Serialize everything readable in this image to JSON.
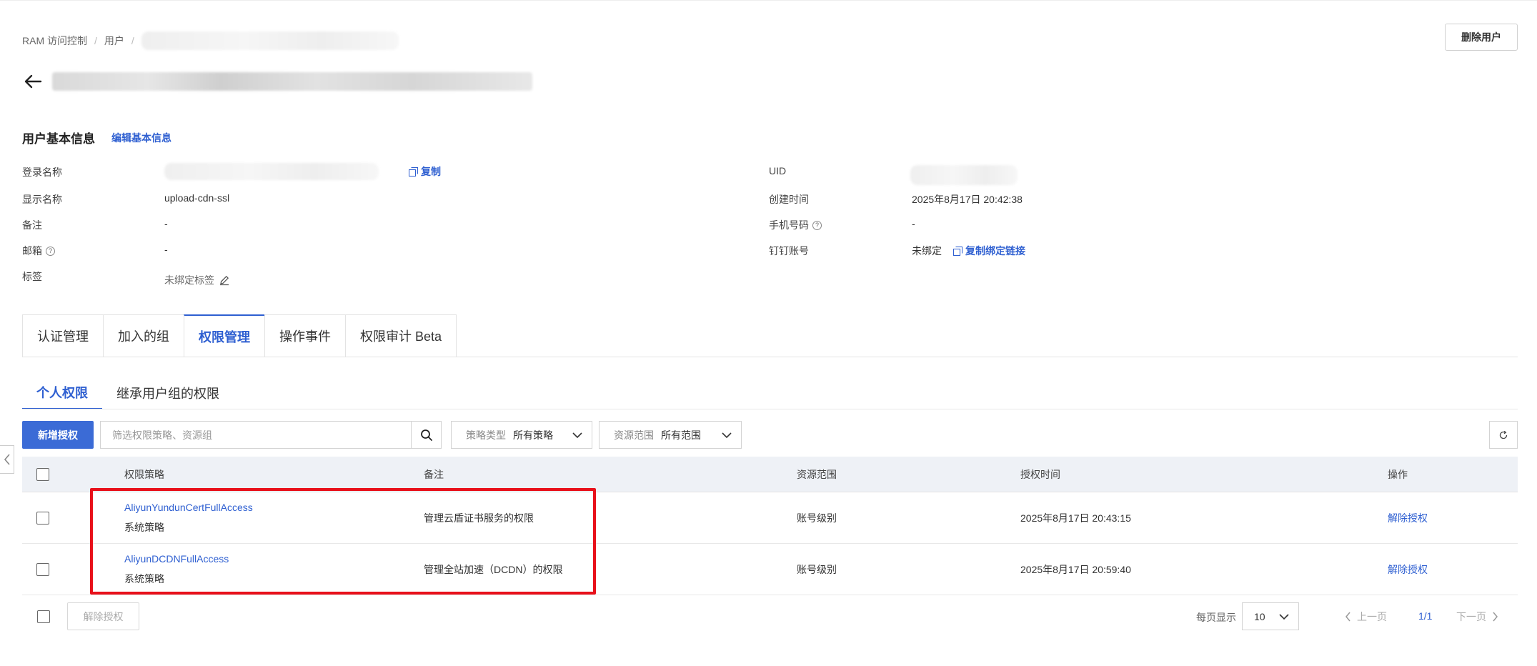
{
  "breadcrumb": {
    "root": "RAM 访问控制",
    "users": "用户"
  },
  "header": {
    "delete_user_label": "删除用户"
  },
  "basic_info": {
    "title": "用户基本信息",
    "edit_label": "编辑基本信息",
    "login_name_label": "登录名称",
    "copy_label": "复制",
    "display_name_label": "显示名称",
    "display_name_value": "upload-cdn-ssl",
    "note_label": "备注",
    "note_value": "-",
    "email_label": "邮箱",
    "email_value": "-",
    "tags_label": "标签",
    "tags_value": "未绑定标签",
    "uid_label": "UID",
    "created_label": "创建时间",
    "created_value": "2025年8月17日 20:42:38",
    "phone_label": "手机号码",
    "phone_value": "-",
    "dingtalk_label": "钉钉账号",
    "dingtalk_value": "未绑定",
    "copy_bind_link_label": "复制绑定链接"
  },
  "main_tabs": [
    {
      "label": "认证管理",
      "active": false
    },
    {
      "label": "加入的组",
      "active": false
    },
    {
      "label": "权限管理",
      "active": true
    },
    {
      "label": "操作事件",
      "active": false
    },
    {
      "label": "权限审计 Beta",
      "active": false
    }
  ],
  "sub_tabs": [
    {
      "label": "个人权限",
      "active": true
    },
    {
      "label": "继承用户组的权限",
      "active": false
    }
  ],
  "toolbar": {
    "add_grant_label": "新增授权",
    "search_placeholder": "筛选权限策略、资源组",
    "policy_type_label": "策略类型",
    "policy_type_value": "所有策略",
    "scope_label": "资源范围",
    "scope_value": "所有范围"
  },
  "table": {
    "headers": {
      "policy": "权限策略",
      "note": "备注",
      "scope": "资源范围",
      "time": "授权时间",
      "op": "操作"
    },
    "rows": [
      {
        "policy": "AliyunYundunCertFullAccess",
        "type": "系统策略",
        "note": "管理云盾证书服务的权限",
        "scope": "账号级别",
        "time": "2025年8月17日 20:43:15",
        "op": "解除授权"
      },
      {
        "policy": "AliyunDCDNFullAccess",
        "type": "系统策略",
        "note": "管理全站加速（DCDN）的权限",
        "scope": "账号级别",
        "time": "2025年8月17日 20:59:40",
        "op": "解除授权"
      }
    ]
  },
  "footer": {
    "revoke_label": "解除授权",
    "per_page_label": "每页显示",
    "per_page_value": "10",
    "prev_label": "上一页",
    "page_count": "1/1",
    "next_label": "下一页"
  },
  "colors": {
    "accent": "#2e5fd1",
    "primary_button": "#3b6bd6",
    "highlight_box": "#e8101a",
    "table_header_bg": "#eef1f6"
  }
}
